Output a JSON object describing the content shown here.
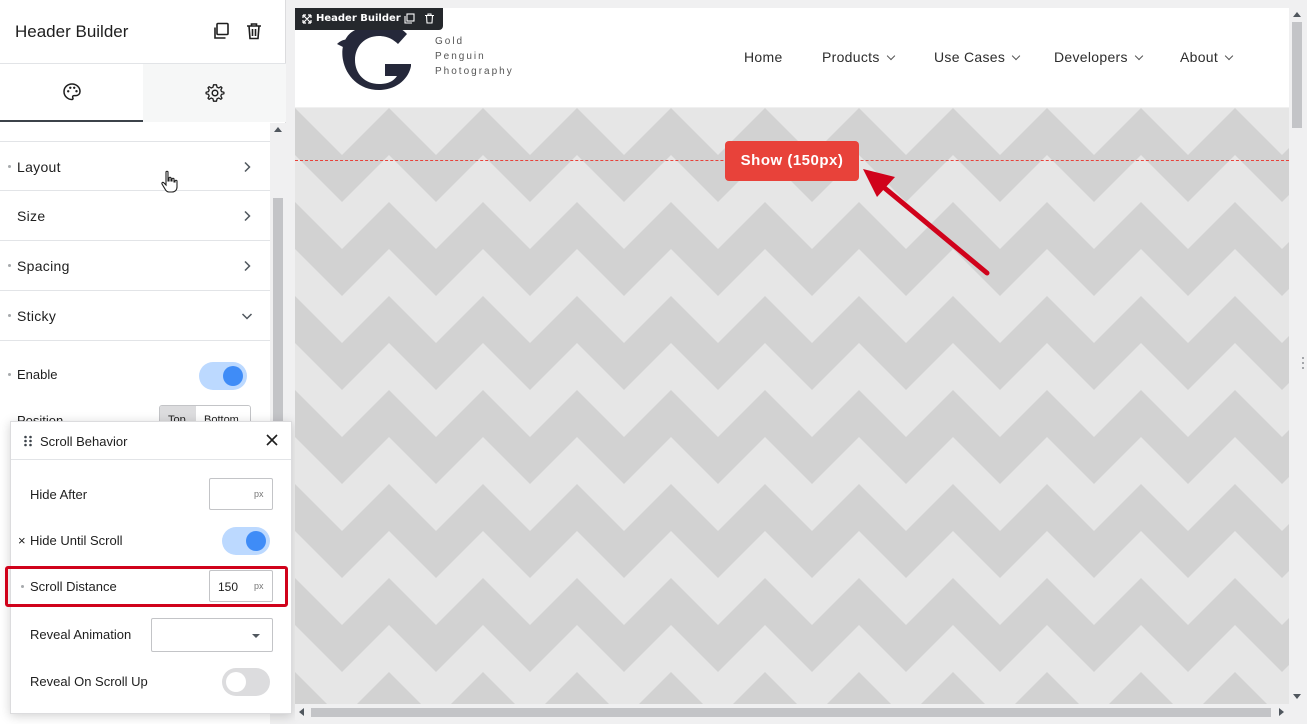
{
  "panel": {
    "title": "Header Builder",
    "tabs": [
      {
        "name": "style",
        "icon": "palette-icon"
      },
      {
        "name": "settings",
        "icon": "gear-icon"
      }
    ],
    "sections": [
      {
        "label": "Layout"
      },
      {
        "label": "Size"
      },
      {
        "label": "Spacing"
      },
      {
        "label": "Sticky"
      }
    ],
    "sticky": {
      "enable_label": "Enable",
      "enable_on": true,
      "position_label": "Position",
      "position_options": [
        "Top",
        "Bottom"
      ],
      "position_selected": "Top"
    }
  },
  "popup": {
    "title": "Scroll Behavior",
    "fields": {
      "hide_after": {
        "label": "Hide After",
        "value": "",
        "unit": "px"
      },
      "hide_until_scroll": {
        "label": "Hide Until Scroll",
        "prefix": "×",
        "on": true
      },
      "scroll_distance": {
        "label": "Scroll Distance",
        "value": "150",
        "unit": "px"
      },
      "reveal_animation": {
        "label": "Reveal Animation",
        "value": ""
      },
      "reveal_on_scroll_up": {
        "label": "Reveal On Scroll Up",
        "on": false
      }
    }
  },
  "canvas": {
    "badge_label": "Header Builder",
    "logo_text": [
      "Gold",
      "Penguin",
      "Photography"
    ],
    "nav": [
      {
        "label": "Home",
        "dropdown": false
      },
      {
        "label": "Products",
        "dropdown": true
      },
      {
        "label": "Use Cases",
        "dropdown": true
      },
      {
        "label": "Developers",
        "dropdown": true
      },
      {
        "label": "About",
        "dropdown": true
      }
    ],
    "show_marker": "Show (150px)"
  },
  "colors": {
    "accent_blue": "#3f8cf7",
    "annotation_red": "#d0021b",
    "marker_red": "#e8423a",
    "pattern_light": "#e8e8e8",
    "pattern_dark": "#cfcfcf"
  }
}
